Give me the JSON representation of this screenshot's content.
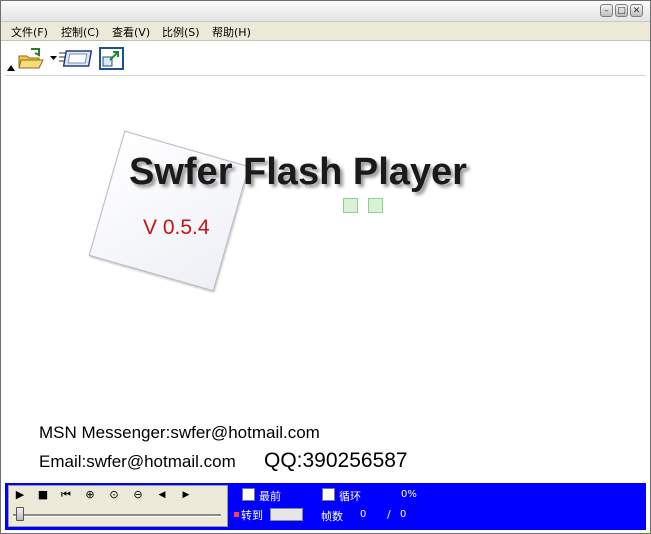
{
  "window": {
    "controls": {
      "minimize": "–",
      "maximize": "□",
      "close": "✕"
    }
  },
  "menu": {
    "items": [
      {
        "label": "文件(F)"
      },
      {
        "label": "控制(C)"
      },
      {
        "label": "查看(V)"
      },
      {
        "label": "比例(S)"
      },
      {
        "label": "帮助(H)"
      }
    ]
  },
  "toolbar": {
    "tools": [
      {
        "name": "open-folder-icon"
      },
      {
        "name": "playlist-dropdown-icon"
      },
      {
        "name": "fullscreen-icon"
      }
    ]
  },
  "splash": {
    "title": "Swfer Flash Player",
    "version": "V 0.5.4",
    "contact_msn": "MSN Messenger:swfer@hotmail.com",
    "contact_email": "Email:swfer@hotmail.com",
    "contact_qq": "QQ:390256587"
  },
  "controls": {
    "play": "▶",
    "stop": "■",
    "rewind": "⏮",
    "zoom_in": "⊕",
    "zoom_reset": "⊙",
    "zoom_out": "⊖",
    "step_back": "◀",
    "step_forward": "▶",
    "topmost_label": "最前",
    "loop_label": "循环",
    "progress_percent": "0%",
    "goto_label": "转到",
    "frames_label": "帧数",
    "current_frame": "0",
    "frame_separator": "/",
    "total_frames": "0"
  },
  "colors": {
    "control_bar": "#0000ff",
    "version_text": "#cc1111",
    "menu_background": "#ece9d8"
  }
}
